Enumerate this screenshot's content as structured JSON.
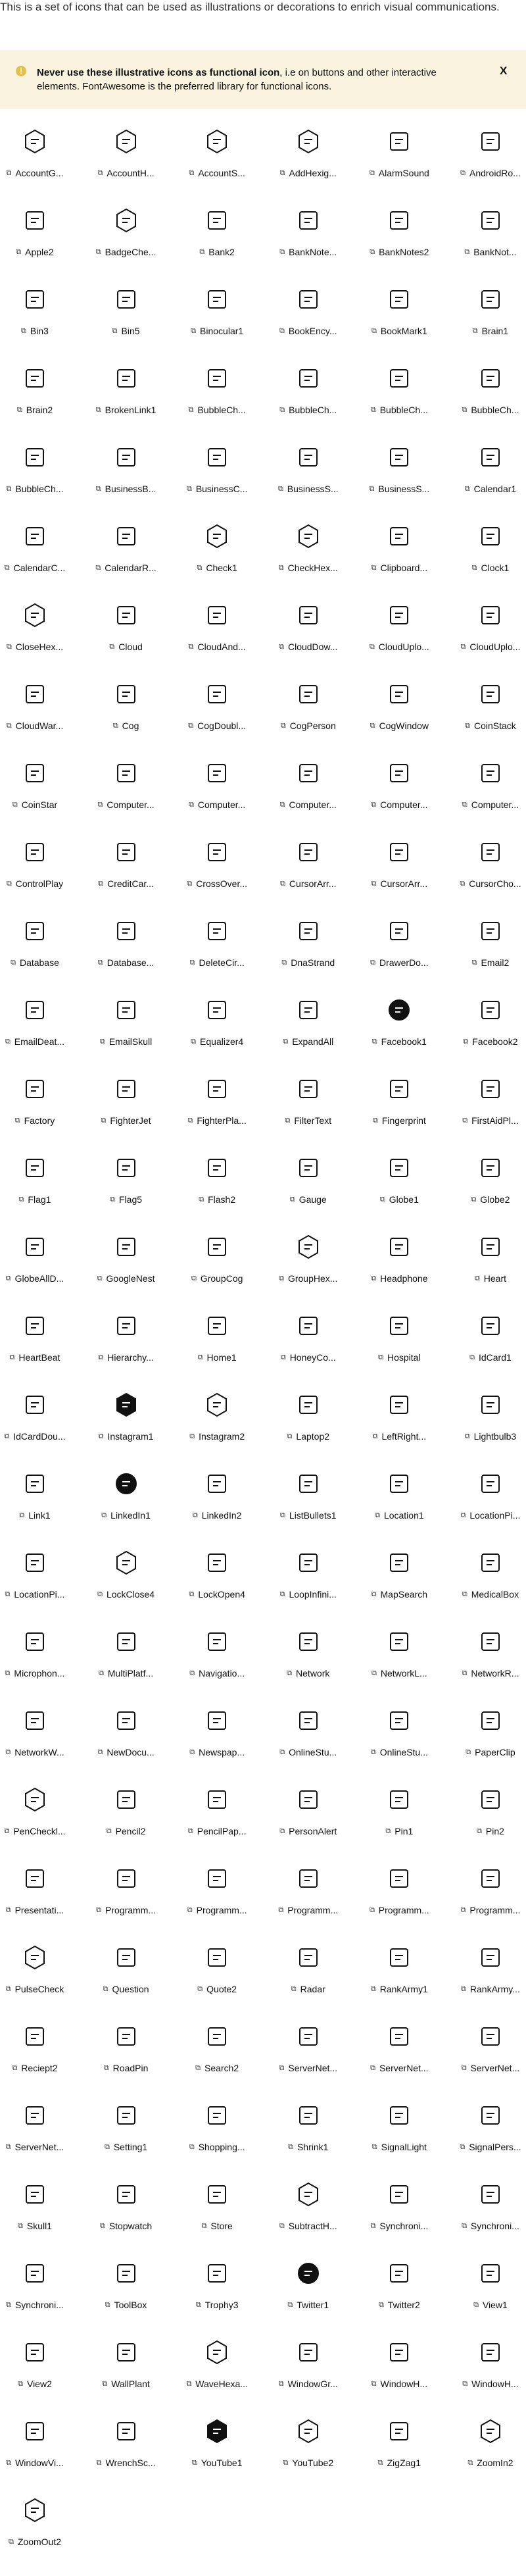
{
  "intro": "This is a set of icons that can be used as illustrations or decorations to enrich visual communications.",
  "banner": {
    "icon": "exclamation-circle-icon",
    "bold": "Never use these illustrative icons as functional icon",
    "text": ", i.e on buttons and other interactive elements. FontAwesome is the preferred library for functional icons.",
    "close": "X"
  },
  "link_glyph": "⧉",
  "icons": [
    "AccountG...",
    "AccountH...",
    "AccountS...",
    "AddHexig...",
    "AlarmSound",
    "AndroidRo...",
    "Apple2",
    "BadgeChe...",
    "Bank2",
    "BankNote...",
    "BankNotes2",
    "BankNot...",
    "Bin3",
    "Bin5",
    "Binocular1",
    "BookEncy...",
    "BookMark1",
    "Brain1",
    "Brain2",
    "BrokenLink1",
    "BubbleCh...",
    "BubbleCh...",
    "BubbleCh...",
    "BubbleCh...",
    "BubbleCh...",
    "BusinessB...",
    "BusinessC...",
    "BusinessS...",
    "BusinessS...",
    "Calendar1",
    "CalendarC...",
    "CalendarR...",
    "Check1",
    "CheckHex...",
    "Clipboard...",
    "Clock1",
    "CloseHex...",
    "Cloud",
    "CloudAnd...",
    "CloudDow...",
    "CloudUplo...",
    "CloudUplo...",
    "CloudWar...",
    "Cog",
    "CogDoubl...",
    "CogPerson",
    "CogWindow",
    "CoinStack",
    "CoinStar",
    "Computer...",
    "Computer...",
    "Computer...",
    "Computer...",
    "Computer...",
    "ControlPlay",
    "CreditCar...",
    "CrossOver...",
    "CursorArr...",
    "CursorArr...",
    "CursorCho...",
    "Database",
    "Database...",
    "DeleteCir...",
    "DnaStrand",
    "DrawerDo...",
    "Email2",
    "EmailDeat...",
    "EmailSkull",
    "Equalizer4",
    "ExpandAll",
    "Facebook1",
    "Facebook2",
    "Factory",
    "FighterJet",
    "FighterPla...",
    "FilterText",
    "Fingerprint",
    "FirstAidPl...",
    "Flag1",
    "Flag5",
    "Flash2",
    "Gauge",
    "Globe1",
    "Globe2",
    "GlobeAllD...",
    "GoogleNest",
    "GroupCog",
    "GroupHex...",
    "Headphone",
    "Heart",
    "HeartBeat",
    "Hierarchy...",
    "Home1",
    "HoneyCo...",
    "Hospital",
    "IdCard1",
    "IdCardDou...",
    "Instagram1",
    "Instagram2",
    "Laptop2",
    "LeftRight...",
    "Lightbulb3",
    "Link1",
    "LinkedIn1",
    "LinkedIn2",
    "ListBullets1",
    "Location1",
    "LocationPi...",
    "LocationPi...",
    "LockClose4",
    "LockOpen4",
    "LoopInfini...",
    "MapSearch",
    "MedicalBox",
    "Microphon...",
    "MultiPlatf...",
    "Navigatio...",
    "Network",
    "NetworkL...",
    "NetworkR...",
    "NetworkW...",
    "NewDocu...",
    "Newspap...",
    "OnlineStu...",
    "OnlineStu...",
    "PaperClip",
    "PenCheckl...",
    "Pencil2",
    "PencilPap...",
    "PersonAlert",
    "Pin1",
    "Pin2",
    "Presentati...",
    "Programm...",
    "Programm...",
    "Programm...",
    "Programm...",
    "Programm...",
    "PulseCheck",
    "Question",
    "Quote2",
    "Radar",
    "RankArmy1",
    "RankArmy...",
    "Reciept2",
    "RoadPin",
    "Search2",
    "ServerNet...",
    "ServerNet...",
    "ServerNet...",
    "ServerNet...",
    "Setting1",
    "Shopping...",
    "Shrink1",
    "SignalLight",
    "SignalPers...",
    "Skull1",
    "Stopwatch",
    "Store",
    "SubtractH...",
    "Synchroni...",
    "Synchroni...",
    "Synchroni...",
    "ToolBox",
    "Trophy3",
    "Twitter1",
    "Twitter2",
    "View1",
    "View2",
    "WallPlant",
    "WaveHexa...",
    "WindowGr...",
    "WindowH...",
    "WindowH...",
    "WindowVi...",
    "WrenchSc...",
    "YouTube1",
    "YouTube2",
    "ZigZag1",
    "ZoomIn2",
    "ZoomOut2"
  ],
  "filled_icons": [
    "Facebook1",
    "Instagram1",
    "LinkedIn1",
    "Twitter1",
    "YouTube1"
  ]
}
